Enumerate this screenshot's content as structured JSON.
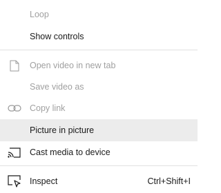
{
  "menu": {
    "items": [
      {
        "label": "Loop",
        "disabled": true
      },
      {
        "label": "Show controls",
        "disabled": false
      },
      {
        "label": "Open video in new tab",
        "disabled": true,
        "icon": "document-icon"
      },
      {
        "label": "Save video as",
        "disabled": true
      },
      {
        "label": "Copy link",
        "disabled": true,
        "icon": "link-icon"
      },
      {
        "label": "Picture in picture",
        "disabled": false,
        "hovered": true
      },
      {
        "label": "Cast media to device",
        "disabled": false,
        "icon": "cast-icon"
      },
      {
        "label": "Inspect",
        "disabled": false,
        "icon": "inspect-icon",
        "shortcut": "Ctrl+Shift+I"
      }
    ]
  },
  "colors": {
    "enabled_text": "#1a1a1a",
    "disabled_text": "#a0a0a0",
    "hover_bg": "#ececec",
    "separator": "#e0e0e0"
  }
}
